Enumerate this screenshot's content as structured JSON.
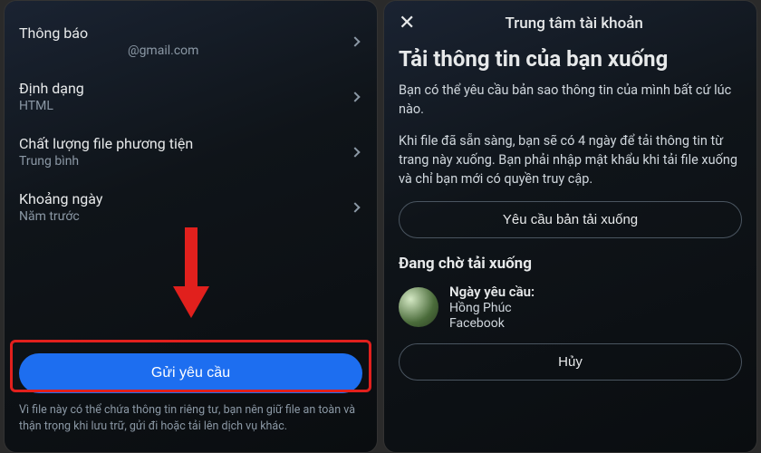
{
  "left": {
    "settings": [
      {
        "label": "Thông báo",
        "value": "@gmail.com"
      },
      {
        "label": "Định dạng",
        "value": "HTML"
      },
      {
        "label": "Chất lượng file phương tiện",
        "value": "Trung bình"
      },
      {
        "label": "Khoảng ngày",
        "value": "Năm trước"
      }
    ],
    "submit_label": "Gửi yêu cầu",
    "footer": "Vì file này có thể chứa thông tin riêng tư, bạn nên giữ file an toàn và thận trọng khi lưu trữ, gửi đi hoặc tải lên dịch vụ khác."
  },
  "right": {
    "header_title": "Trung tâm tài khoản",
    "page_title": "Tải thông tin của bạn xuống",
    "para1": "Bạn có thể yêu cầu bản sao thông tin của mình bất cứ lúc nào.",
    "para2": "Khi file đã sẵn sàng, bạn sẽ có 4 ngày để tải thông tin từ trang này xuống. Bạn phải nhập mật khẩu khi tải file xuống và chỉ bạn mới có quyền truy cập.",
    "request_btn": "Yêu cầu bản tải xuống",
    "pending_heading": "Đang chờ tải xuống",
    "pending": {
      "date_label": "Ngày yêu cầu:",
      "name": "Hồng Phúc",
      "platform": "Facebook"
    },
    "cancel_btn": "Hủy"
  }
}
